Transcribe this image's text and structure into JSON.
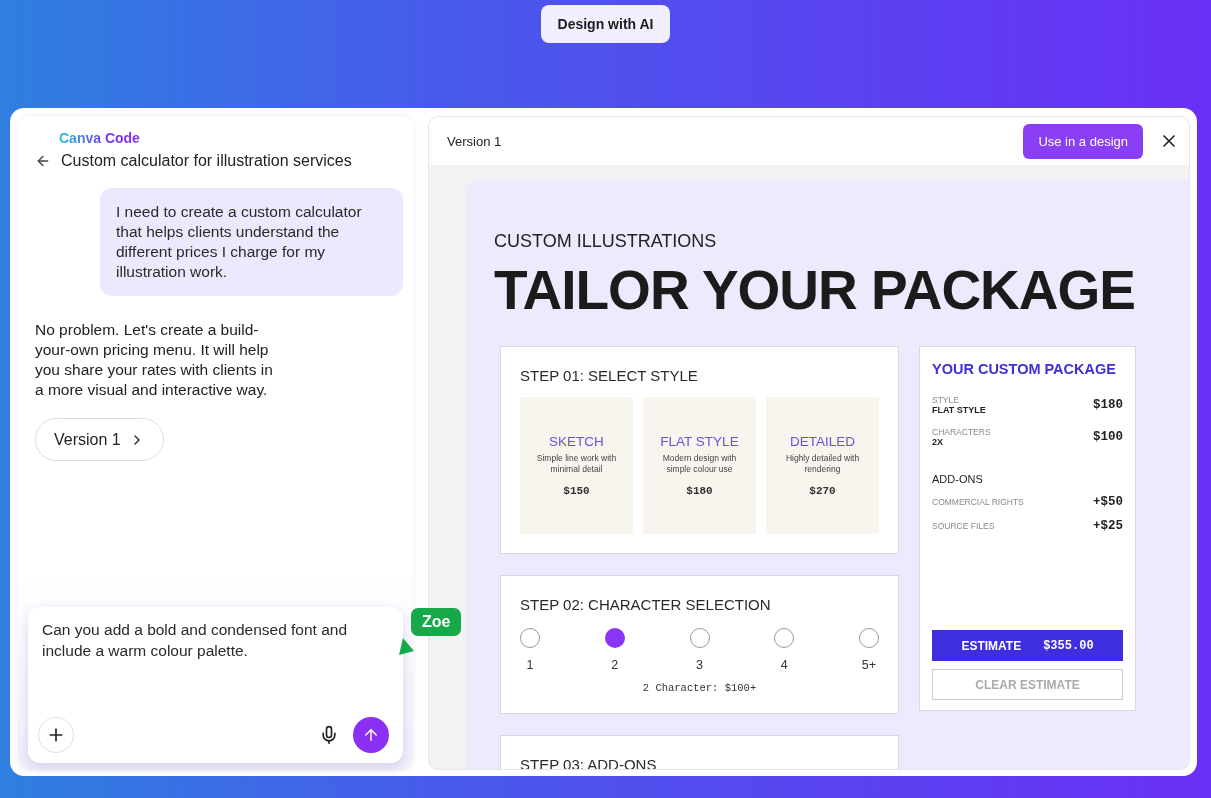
{
  "top_badge": "Design with AI",
  "chat": {
    "brand": "Canva Code",
    "title": "Custom calculator for illustration services",
    "messages": [
      {
        "kind": "user",
        "text": "I need to create a custom calculator that helps clients understand the different prices I charge for my illustration work."
      },
      {
        "kind": "assistant",
        "text": "No problem. Let's create a build-your-own pricing menu. It will help you share your rates with clients in a more visual and interactive way."
      }
    ],
    "version_chip": "Version 1",
    "input": {
      "value": "Can you add a bold and condensed font and include a warm colour palette."
    },
    "cursor_label": "Zoe"
  },
  "preview": {
    "version": "Version 1",
    "use_button": "Use in a design",
    "eyebrow": "CUSTOM ILLUSTRATIONS",
    "headline": "TAILOR YOUR PACKAGE",
    "step1": {
      "title": "STEP 01: SELECT STYLE",
      "styles": [
        {
          "name": "SKETCH",
          "description": "Simple line work with minimal detail",
          "price": "$150"
        },
        {
          "name": "FLAT STYLE",
          "description": "Modern design with simple colour use",
          "price": "$180"
        },
        {
          "name": "DETAILED",
          "description": "Highly detailed with rendering",
          "price": "$270"
        }
      ]
    },
    "step2": {
      "title": "STEP 02: CHARACTER SELECTION",
      "options": [
        {
          "label": "1",
          "selected": false
        },
        {
          "label": "2",
          "selected": true
        },
        {
          "label": "3",
          "selected": false
        },
        {
          "label": "4",
          "selected": false
        },
        {
          "label": "5+",
          "selected": false
        }
      ],
      "note": "2 Character: $100+"
    },
    "step3": {
      "title": "STEP 03: ADD-ONS"
    },
    "summary": {
      "title": "YOUR CUSTOM PACKAGE",
      "items": [
        {
          "label": "STYLE",
          "value": "FLAT STYLE",
          "price": "$180"
        },
        {
          "label": "CHARACTERS",
          "value": "2X",
          "price": "$100"
        }
      ],
      "addons_title": "ADD-ONS",
      "addons": [
        {
          "label": "COMMERCIAL RIGHTS",
          "price": "+$50"
        },
        {
          "label": "SOURCE FILES",
          "price": "+$25"
        }
      ],
      "estimate_label": "ESTIMATE",
      "estimate_value": "$355.00",
      "clear": "CLEAR ESTIMATE"
    }
  }
}
